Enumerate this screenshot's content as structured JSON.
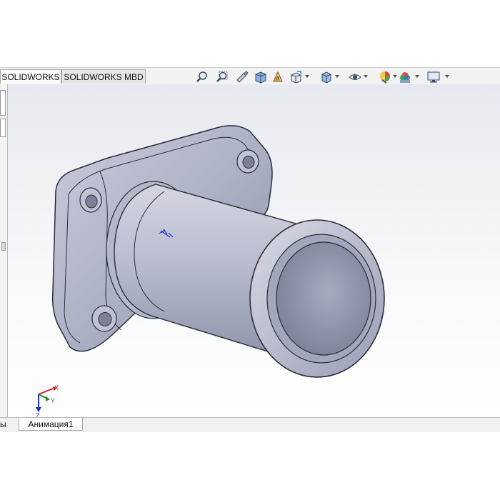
{
  "tabs": [
    {
      "label": "SOLIDWORKS",
      "active": true
    },
    {
      "label": "SOLIDWORKS MBD",
      "active": false
    }
  ],
  "view_toolbar": {
    "icons": [
      "zoom-to-fit-icon",
      "zoom-to-area-icon",
      "previous-view-icon",
      "section-view-icon",
      "dynamic-annotation-views-icon",
      "view-orientation-icon",
      "display-style-icon",
      "hide-show-items-icon",
      "edit-appearance-icon",
      "apply-scene-icon",
      "view-settings-icon"
    ]
  },
  "bottom_tabs": {
    "partial_label": "ы",
    "animation_tab": "Анимация1"
  },
  "triad": {
    "x_label": "X",
    "y_label": "Y",
    "z_label": "Z",
    "colors": {
      "x": "#d42020",
      "y": "#1e8c2a",
      "z": "#1a2fd0"
    }
  },
  "colors": {
    "model_body": "#b9bdcf",
    "model_edge": "#2b2d36",
    "viewport_top": "#e6e9ef",
    "origin_marker": "#1a2fd0"
  }
}
